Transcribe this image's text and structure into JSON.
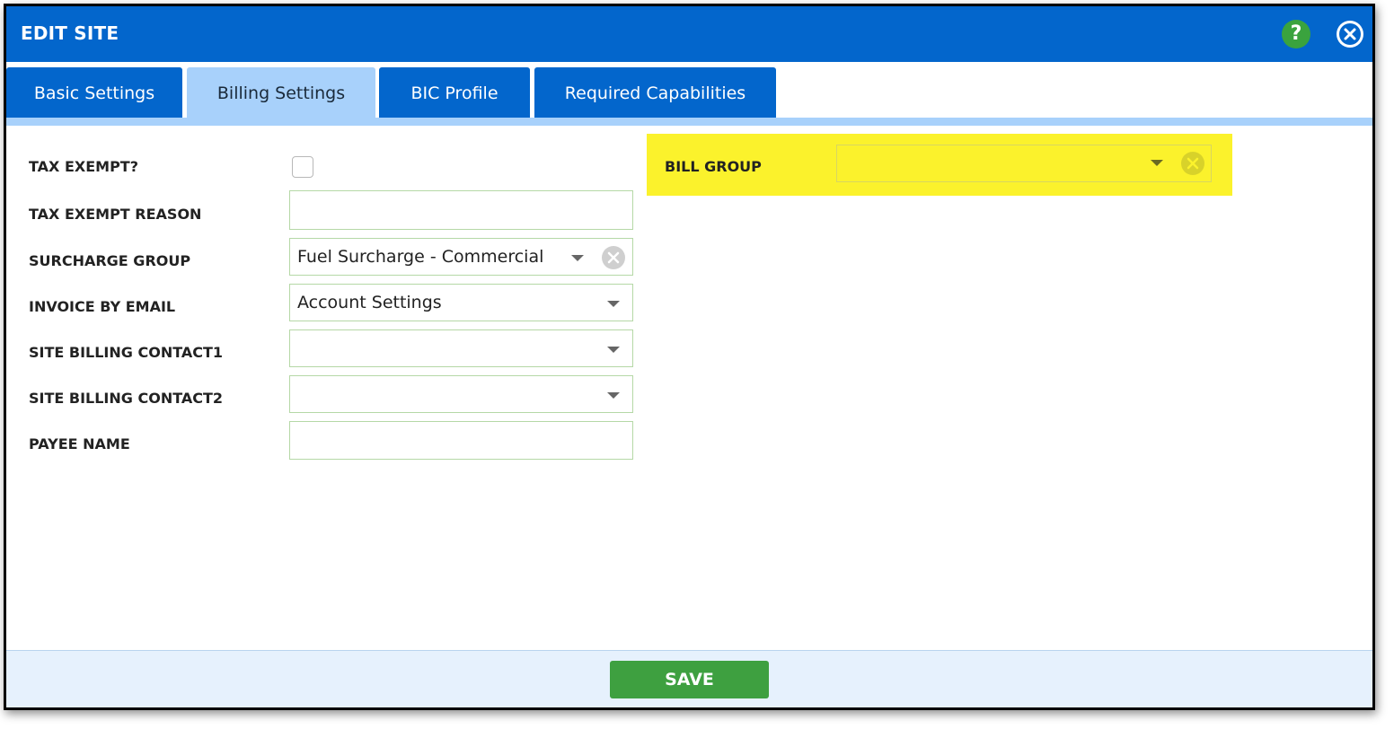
{
  "dialog": {
    "title": "EDIT SITE",
    "help_label": "?",
    "help_icon": "help-icon",
    "close_icon": "close-icon",
    "colors": {
      "header": "#0366cc",
      "tab_active": "#a8d1fb",
      "highlight": "#fbf22c",
      "save": "#3ea040"
    }
  },
  "tabs": [
    {
      "label": "Basic Settings",
      "active": false
    },
    {
      "label": "Billing Settings",
      "active": true
    },
    {
      "label": "BIC Profile",
      "active": false
    },
    {
      "label": "Required Capabilities",
      "active": false
    }
  ],
  "fields": {
    "tax_exempt": {
      "label": "TAX EXEMPT?",
      "checked": false
    },
    "tax_exempt_reason": {
      "label": "TAX EXEMPT REASON",
      "value": ""
    },
    "surcharge_group": {
      "label": "SURCHARGE GROUP",
      "value": "Fuel Surcharge - Commercial"
    },
    "invoice_by_email": {
      "label": "INVOICE BY EMAIL",
      "value": "Account Settings"
    },
    "site_billing_contact1": {
      "label": "SITE BILLING CONTACT1",
      "value": ""
    },
    "site_billing_contact2": {
      "label": "SITE BILLING CONTACT2",
      "value": ""
    },
    "payee_name": {
      "label": "PAYEE NAME",
      "value": ""
    },
    "bill_group": {
      "label": "BILL GROUP",
      "value": ""
    }
  },
  "footer": {
    "save_label": "SAVE"
  }
}
